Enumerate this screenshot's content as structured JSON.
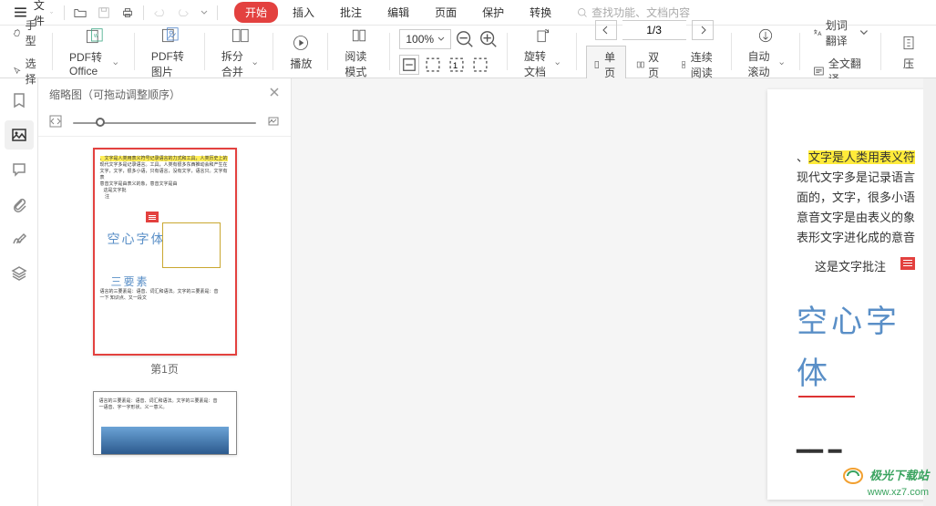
{
  "menu": {
    "file_label": "文件",
    "tabs": [
      "开始",
      "插入",
      "批注",
      "编辑",
      "页面",
      "保护",
      "转换"
    ],
    "active_tab_index": 0,
    "search_placeholder": "查找功能、文档内容"
  },
  "ribbon": {
    "hand_tool": "手型",
    "select_tool": "选择",
    "pdf_to_office": "PDF转Office",
    "pdf_to_image": "PDF转图片",
    "split_merge": "拆分合并",
    "play": "播放",
    "reading_mode": "阅读模式",
    "zoom_value": "100%",
    "rotate_doc": "旋转文档",
    "page_indicator": "1/3",
    "single_page": "单页",
    "double_page": "双页",
    "continuous": "连续阅读",
    "auto_scroll": "自动滚动",
    "word_translate": "划词翻译",
    "fulltext_translate": "全文翻译",
    "compress": "压"
  },
  "thumbnail_panel": {
    "title": "缩略图（可拖动调整顺序）",
    "page1_label": "第1页"
  },
  "document": {
    "line1_prefix": "、",
    "line1_highlight": "文字是人类用表义符",
    "line2": "现代文字多是记录语言",
    "line3": "面的，文字，很多小语",
    "line4": "意音文字是由表义的象",
    "line5": "表形文字进化成的意音",
    "annotation_label": "这是文字批注",
    "outline_text": "空心字体",
    "thumb_blue1": "空心字体",
    "thumb_blue2": "三要素"
  },
  "watermark": {
    "name": "极光下载站",
    "url": "www.xz7.com"
  },
  "icons": {
    "hamburger": "hamburger-icon",
    "dropdown": "chevron-down-icon",
    "folder_open": "folder-open-icon",
    "save": "save-icon",
    "print": "print-icon",
    "undo": "undo-icon",
    "redo": "redo-icon",
    "search": "search-icon",
    "hand": "hand-icon",
    "cursor": "cursor-icon",
    "play": "play-circle-icon",
    "book": "book-icon",
    "rotate": "rotate-icon",
    "close": "close-icon",
    "bookmark": "bookmark-icon",
    "image": "image-icon",
    "comment": "comment-icon",
    "attachment": "attachment-icon",
    "signature": "signature-icon",
    "layers": "layers-icon"
  }
}
